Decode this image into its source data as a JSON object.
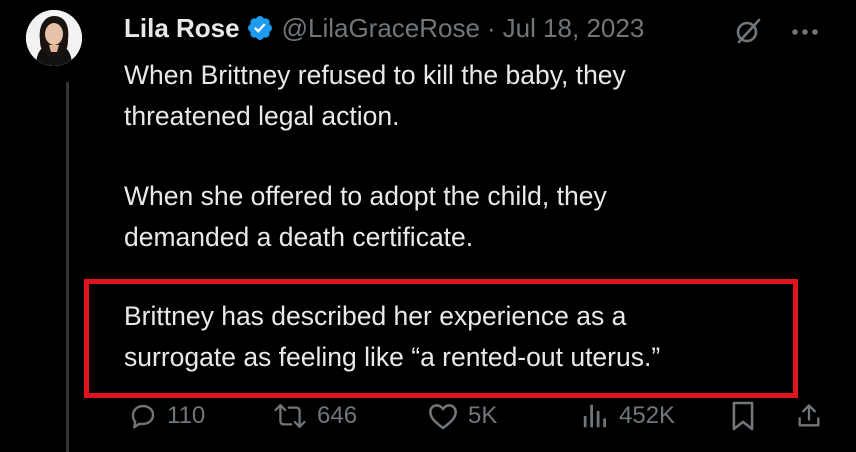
{
  "tweet": {
    "author_name": "Lila Rose",
    "handle": "@LilaGraceRose",
    "separator": "·",
    "date": "Jul 18, 2023",
    "paragraphs": [
      [
        "When Brittney refused to kill the baby, they",
        "threatened legal action."
      ],
      [
        "When she offered to adopt the child, they",
        "demanded a death certificate."
      ],
      [
        "Brittney has described her experience as a",
        "surrogate as feeling like “a rented-out uterus.”"
      ]
    ],
    "highlight_color": "#e0141e"
  },
  "actions": {
    "replies": "110",
    "reposts": "646",
    "likes": "5K",
    "views": "452K"
  },
  "icons": {
    "verified": "verified-badge-icon",
    "grok": "grok-icon",
    "more": "more-icon",
    "reply": "reply-icon",
    "repost": "repost-icon",
    "like": "like-icon",
    "views": "views-icon",
    "bookmark": "bookmark-icon",
    "share": "share-icon"
  },
  "colors": {
    "background": "#000000",
    "text": "#e7e9ea",
    "muted": "#71767b",
    "verified": "#1d9bf0"
  }
}
